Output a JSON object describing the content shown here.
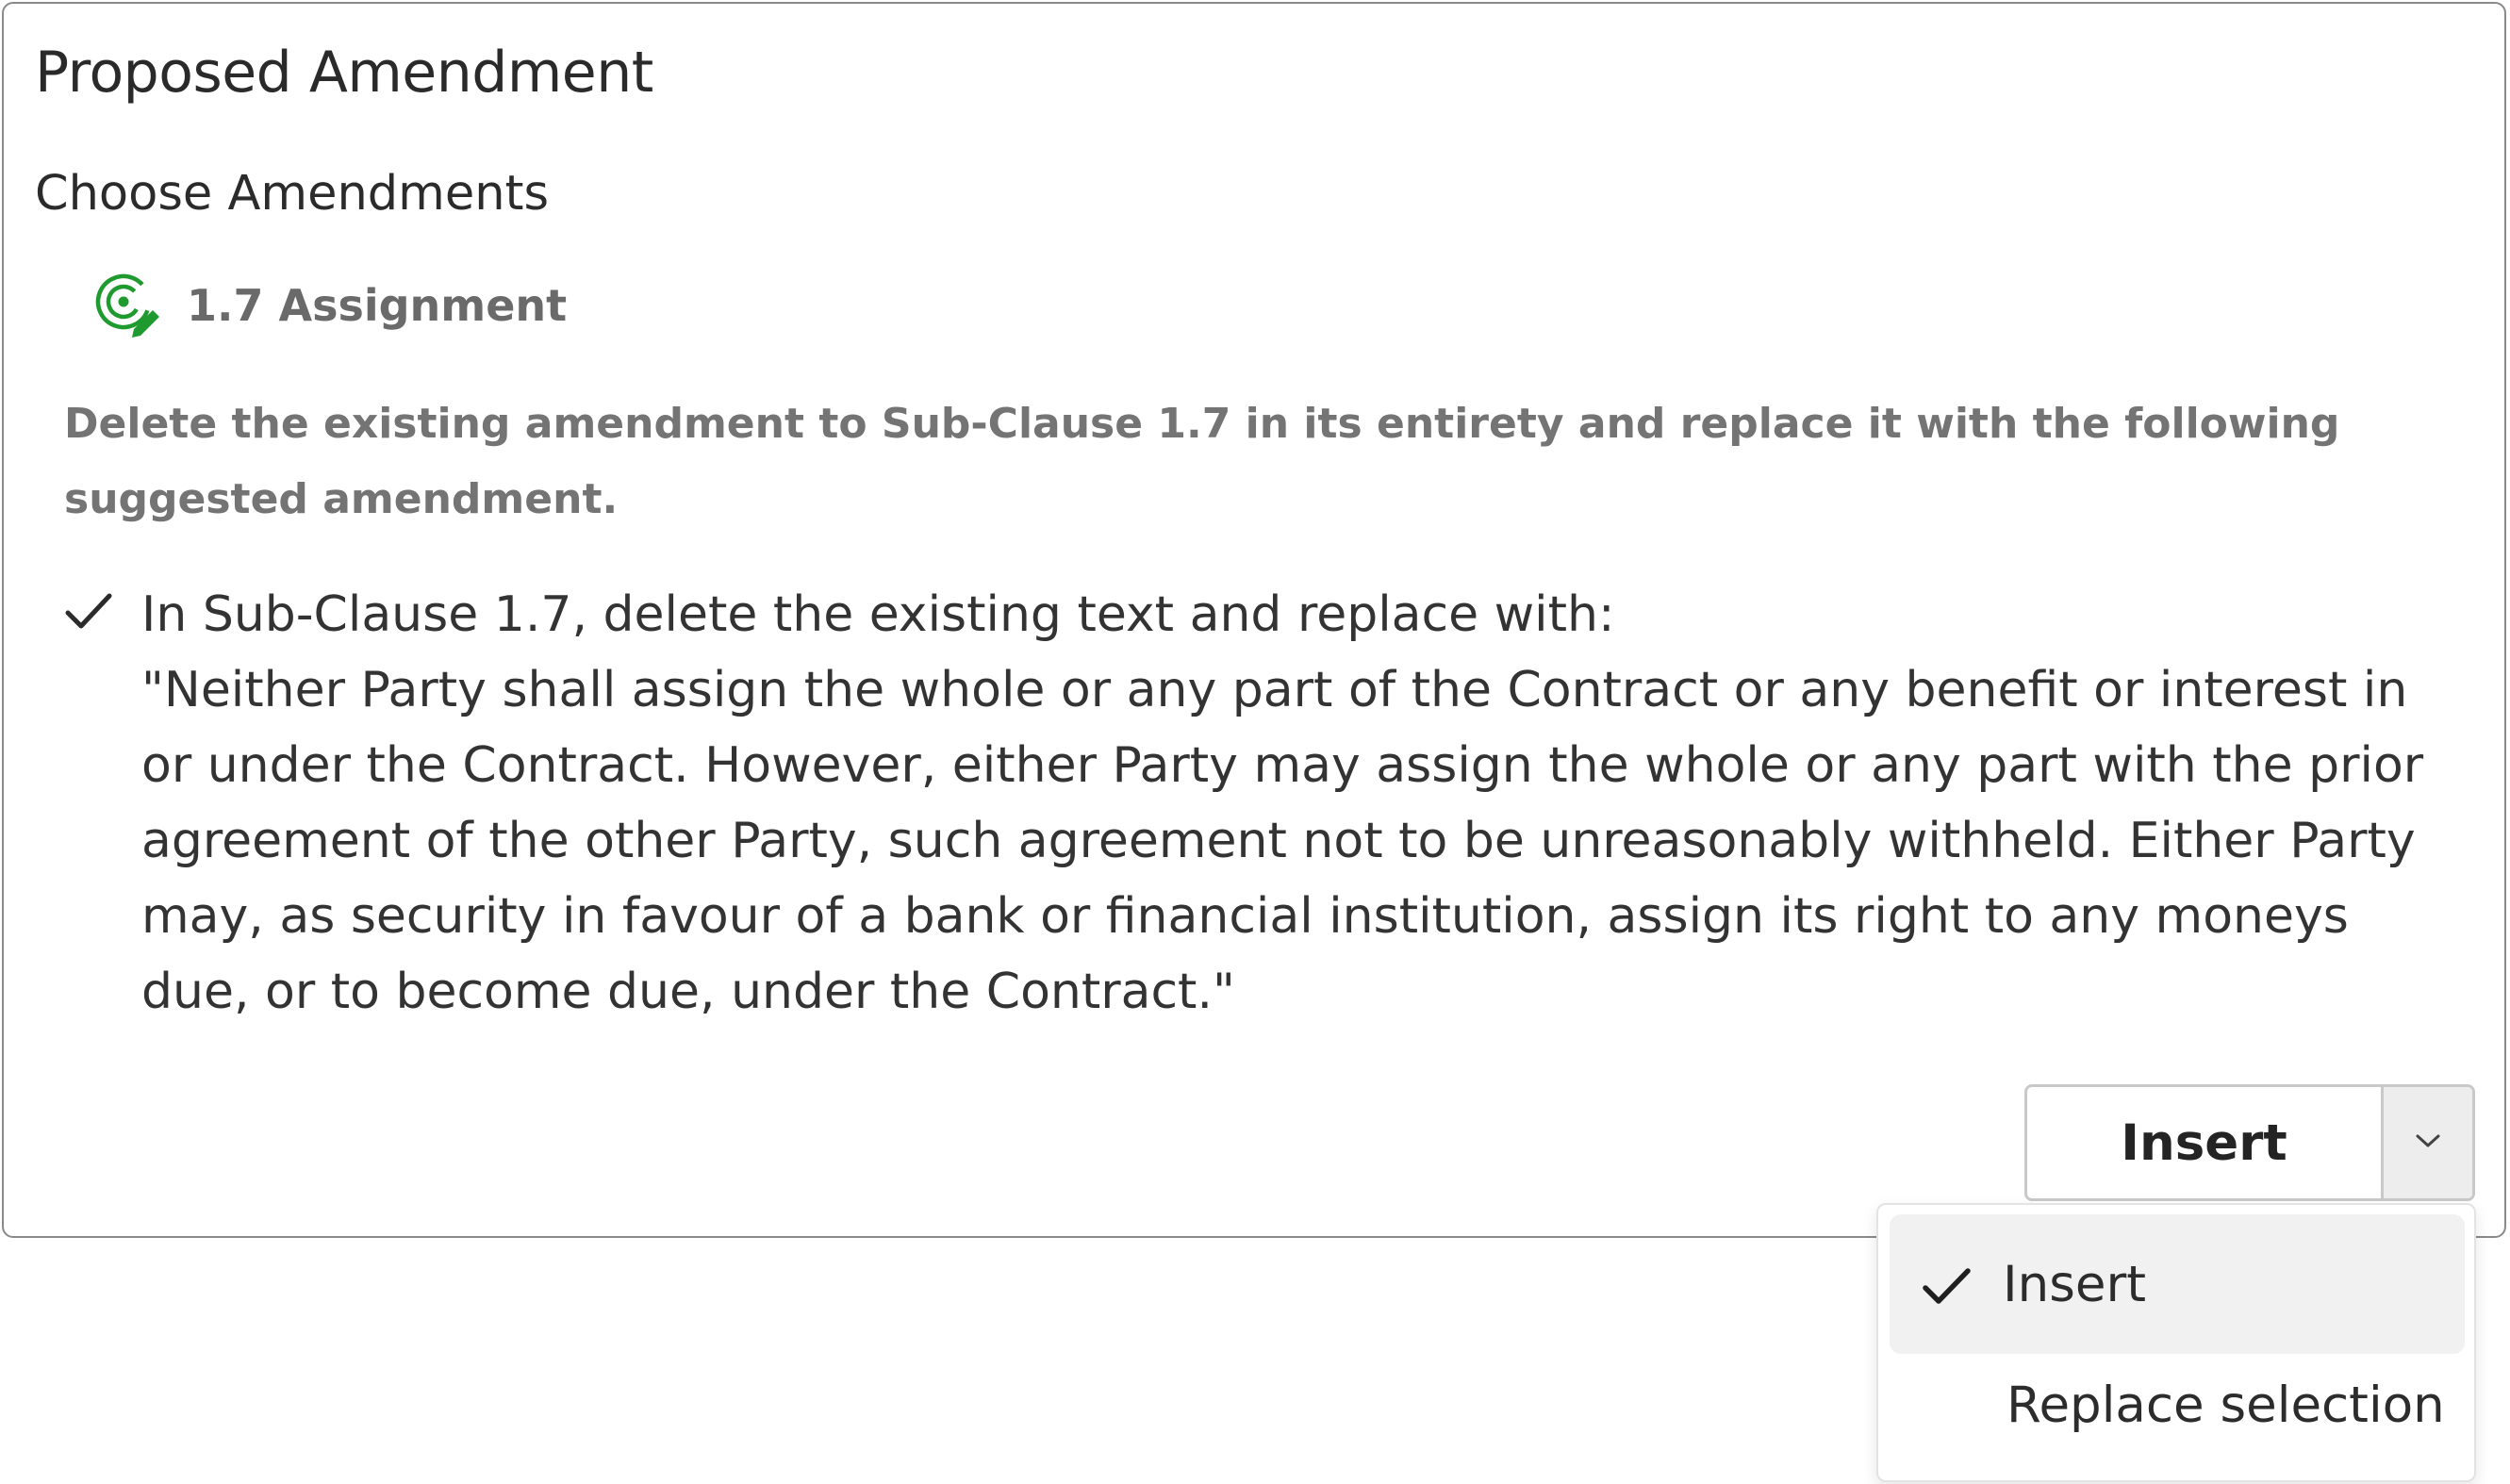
{
  "panel": {
    "title": "Proposed Amendment",
    "section_heading": "Choose Amendments",
    "clause": {
      "icon": "target-edit-icon",
      "icon_color": "#1f9a2e",
      "label": "1.7 Assignment"
    },
    "instruction": "Delete the existing amendment to Sub-Clause 1.7 in its entirety and replace it with the following suggested amendment.",
    "option": {
      "checked": true,
      "icon": "check-icon",
      "lead": "In Sub-Clause 1.7, delete the existing text and replace with:",
      "quote": "\"Neither Party shall assign the whole or any part of the Contract or any benefit or interest in or under the Contract. However, either Party may assign the whole or any part with the prior agreement of the other Party, such agreement not to be unreasonably withheld. Either Party may, as security in favour of a bank or financial institution, assign its right to any moneys due, or to become due, under the Contract.\""
    }
  },
  "action_button": {
    "label": "Insert",
    "toggle_icon": "chevron-down-icon"
  },
  "dropdown": {
    "items": [
      {
        "label": "Insert",
        "selected": true
      },
      {
        "label": "Replace selection",
        "selected": false
      }
    ]
  }
}
